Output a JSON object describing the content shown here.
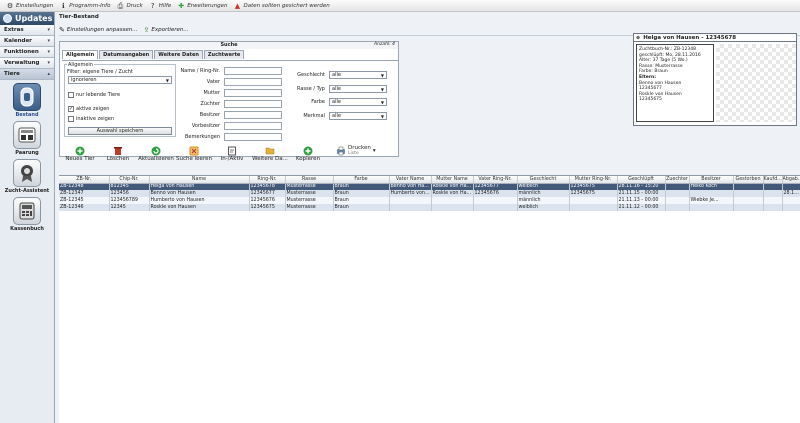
{
  "menubar": [
    {
      "icon": "wrench-icon",
      "glyph": "⚙",
      "label": "Einstellungen"
    },
    {
      "icon": "info-icon",
      "glyph": "ℹ",
      "label": "Programm-Info"
    },
    {
      "icon": "printer-icon",
      "glyph": "⎙",
      "label": "Druck"
    },
    {
      "icon": "help-icon",
      "glyph": "?",
      "label": "Hilfe"
    },
    {
      "icon": "plus-icon",
      "glyph": "✚",
      "label": "Erweiterungen"
    },
    {
      "icon": "warning-icon",
      "glyph": "▲",
      "label": "Daten sollten gesichert werden"
    }
  ],
  "sidebar": {
    "header": "Updates",
    "sections": [
      "Extras",
      "Kalender",
      "Funktionen",
      "Verwaltung"
    ],
    "open_section": "Tiere",
    "tools": [
      {
        "name": "Bestand",
        "icon": "animal-icon"
      },
      {
        "name": "Paarung",
        "icon": "pairing-icon"
      },
      {
        "name": "Zucht-Assistent",
        "icon": "rosette-icon"
      },
      {
        "name": "Kassenbuch",
        "icon": "calculator-icon"
      }
    ]
  },
  "page": {
    "title": "Tier-Bestand",
    "action1": "Einstellungen anpassen...",
    "action2": "Exportieren..."
  },
  "search": {
    "title": "Suche",
    "count": "Anzahl: 4",
    "tabs": [
      "Allgemein",
      "Datumsangaben",
      "Weitere Daten",
      "Zuchtwerte"
    ],
    "group_label": "Allgemein",
    "filter_label": "Filter: eigene Tiere / Zucht",
    "filter_value": "ignorieren",
    "chk1": "nur lebende Tiere",
    "chk2": "aktive zeigen",
    "chk3": "inaktive zeigen",
    "save_btn": "Auswahl speichern",
    "fields": [
      "Name / Ring-Nr.",
      "Vater",
      "Mutter",
      "Züchter",
      "Besitzer",
      "Vorbesitzer",
      "Bemerkungen"
    ],
    "right_fields": [
      "Geschlecht",
      "Rasse / Typ",
      "Farbe",
      "Merkmal"
    ],
    "right_value": "alle"
  },
  "preview": {
    "header": "Helga von Hausen - 12345678",
    "lines": [
      "Zuchtbuch-Nr.: ZB-12348",
      "geschlüpft: Mo, 28.11.2016",
      "Alter: 37 Tage (5 Wo.)",
      "Rasse: Musterrasse",
      "Farbe: Braun",
      "Eltern:",
      "Benno von Hausen",
      "12345677",
      "Roskle von Hausen",
      "12345675"
    ]
  },
  "toolbar": [
    {
      "label": "Neues Tier",
      "icon": "add-icon",
      "color": "#2ea043"
    },
    {
      "label": "Löschen",
      "icon": "delete-icon",
      "color": "#c0392b"
    },
    {
      "label": "Aktualisieren",
      "icon": "refresh-icon",
      "color": "#2ea043"
    },
    {
      "label": "Suche leeren",
      "icon": "clear-search-icon",
      "color": "#e08a1e"
    },
    {
      "label": "In-/Aktiv",
      "icon": "toggle-active-icon",
      "color": "#555"
    },
    {
      "label": "Weitere Da...",
      "icon": "folder-icon",
      "color": "#e3b23c"
    },
    {
      "label": "Kopieren",
      "icon": "copy-icon",
      "color": "#2ea043"
    }
  ],
  "print": {
    "label": "Drucken",
    "sub": "Liste"
  },
  "grid": {
    "columns": [
      "ZB-Nr.",
      "Chip-Nr.",
      "Name",
      "Ring-Nr.",
      "Rasse",
      "Farbe",
      "Vater Name",
      "Mutter Name",
      "Vater Ring-Nr.",
      "Geschlecht",
      "Mutter Ring-Nr.",
      "Geschlüpft",
      "Zuechter",
      "Besitzer",
      "Gestorben",
      "Kaufd...",
      "Abgab..."
    ],
    "rows": [
      [
        "ZB-12348",
        "812345",
        "Helga von Hausen",
        "12345678",
        "Musterrasse",
        "Braun",
        "Benno von Ha...",
        "Roskle von Ha...",
        "12345677",
        "weiblich",
        "12345675",
        "28.11.16 - 15:20",
        "",
        "Heiko Koch",
        "",
        "",
        ""
      ],
      [
        "ZB-12347",
        "123456",
        "Benno von Hausen",
        "12345677",
        "Musterrasse",
        "Braun",
        "Humberto von...",
        "Roskle von Ha...",
        "12345676",
        "männlich",
        "12345675",
        "21.11.15 - 00:00",
        "",
        "",
        "",
        "",
        "28.11...."
      ],
      [
        "ZB-12345",
        "123456789",
        "Humberto von Hausen",
        "12345676",
        "Musterrasse",
        "Braun",
        "",
        "",
        "",
        "männlich",
        "",
        "21.11.13 - 00:00",
        "",
        "Wiebke Je...",
        "",
        "",
        ""
      ],
      [
        "ZB-12346",
        "12345",
        "Roskle von Hausen",
        "12345675",
        "Musterrasse",
        "Braun",
        "",
        "",
        "",
        "weiblich",
        "",
        "21.11.12 - 00:00",
        "",
        "",
        "",
        "",
        ""
      ]
    ]
  }
}
